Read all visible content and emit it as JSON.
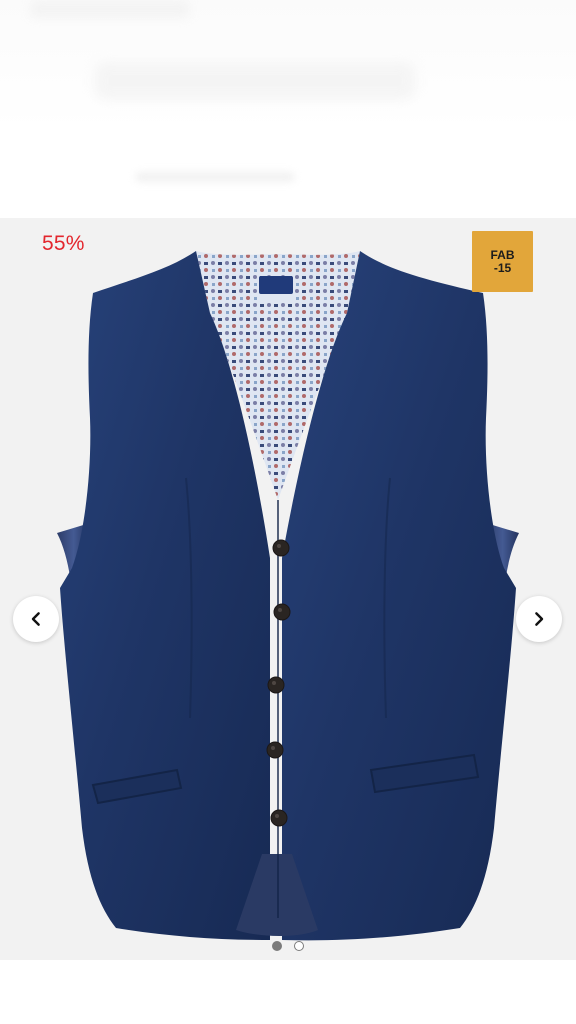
{
  "product": {
    "discount_label": "55%",
    "promo_tag_lines": [
      "FAB",
      "-15"
    ],
    "image_alt_icon": "vest-product-image"
  },
  "gallery": {
    "current_index": 1,
    "total_images": 2,
    "prev_icon": "chevron-left-icon",
    "next_icon": "chevron-right-icon"
  },
  "colors": {
    "discount": "#e3262d",
    "promo_tag_bg": "#e2a63a",
    "vest_navy": "#1f3566",
    "gallery_bg": "#f2f2f2"
  }
}
